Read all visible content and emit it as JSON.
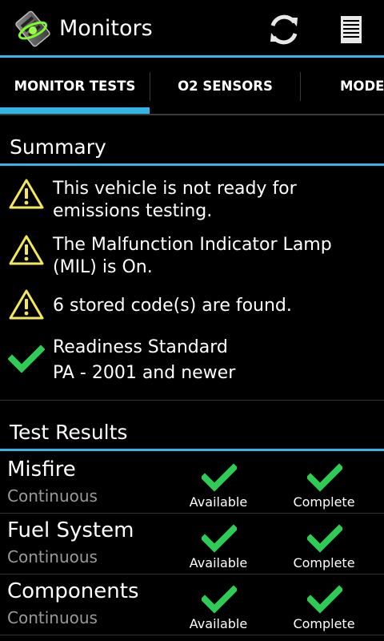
{
  "actionbar": {
    "title": "Monitors",
    "refresh_icon": "refresh-icon",
    "menu_icon": "list-menu-icon"
  },
  "tabs": [
    {
      "label": "MONITOR TESTS",
      "selected": true
    },
    {
      "label": "O2 SENSORS",
      "selected": false
    },
    {
      "label": "MODE",
      "selected": false
    }
  ],
  "summary": {
    "title": "Summary",
    "items": [
      {
        "icon": "warning-icon",
        "lines": [
          "This vehicle is not ready for",
          "emissions testing."
        ]
      },
      {
        "icon": "warning-icon",
        "lines": [
          "The Malfunction Indicator Lamp",
          "(MIL) is On."
        ]
      },
      {
        "icon": "warning-icon",
        "lines": [
          "6 stored code(s) are found."
        ]
      },
      {
        "icon": "checkmark-icon",
        "lines": [
          "Readiness Standard",
          "PA - 2001 and newer"
        ]
      }
    ]
  },
  "test_results": {
    "title": "Test Results",
    "rows": [
      {
        "name": "Misfire",
        "type": "Continuous",
        "availability": "Available",
        "completion": "Complete"
      },
      {
        "name": "Fuel System",
        "type": "Continuous",
        "availability": "Available",
        "completion": "Complete"
      },
      {
        "name": "Components",
        "type": "Continuous",
        "availability": "Available",
        "completion": "Complete"
      }
    ]
  },
  "colors": {
    "accent": "#33b5e5",
    "check": "#2ecc55",
    "warning": "#f3e85a"
  }
}
